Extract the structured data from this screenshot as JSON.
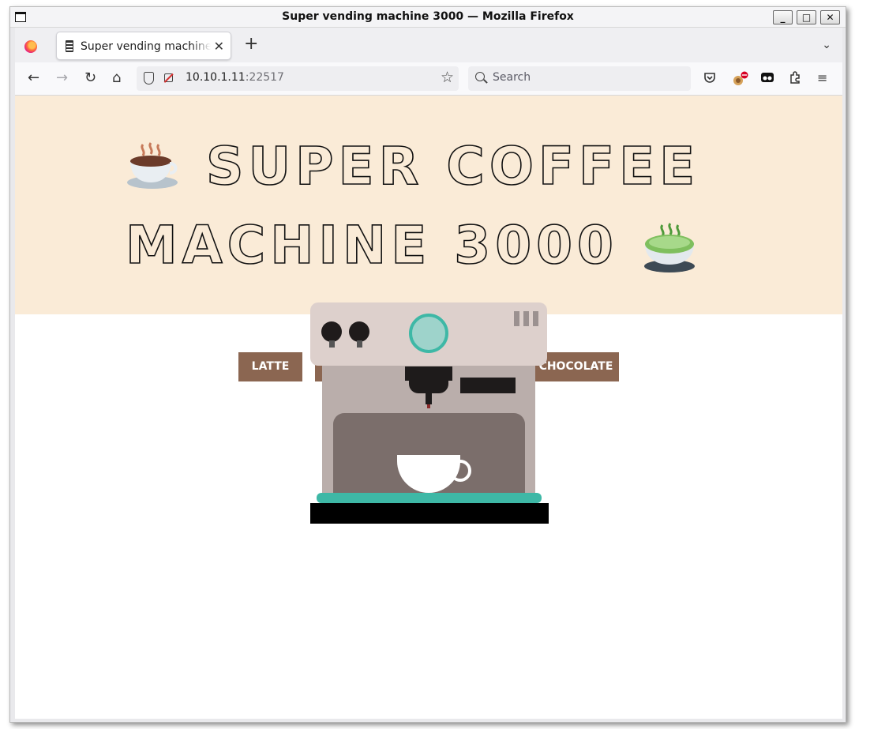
{
  "window": {
    "title": "Super vending machine 3000 — Mozilla Firefox",
    "controls": [
      "_",
      "□",
      "✕"
    ]
  },
  "tabs": [
    {
      "title": "Super vending machine 3000",
      "active": true
    }
  ],
  "toolbar": {
    "url_host": "10.10.1.11",
    "url_port": ":22517",
    "search_placeholder": "Search"
  },
  "page": {
    "headline_line1": "SUPER COFFEE",
    "headline_line2": "MACHINE 3000",
    "left_emoji": "hot-beverage",
    "right_emoji": "teacup-without-handle",
    "hero_color": "#faebd7",
    "products": [
      {
        "label": "LATTE"
      },
      {
        "label": ""
      },
      {
        "label": "CHOCOLATE"
      }
    ],
    "button_color": "#8b6651",
    "accent_color": "#3eb8a6"
  }
}
